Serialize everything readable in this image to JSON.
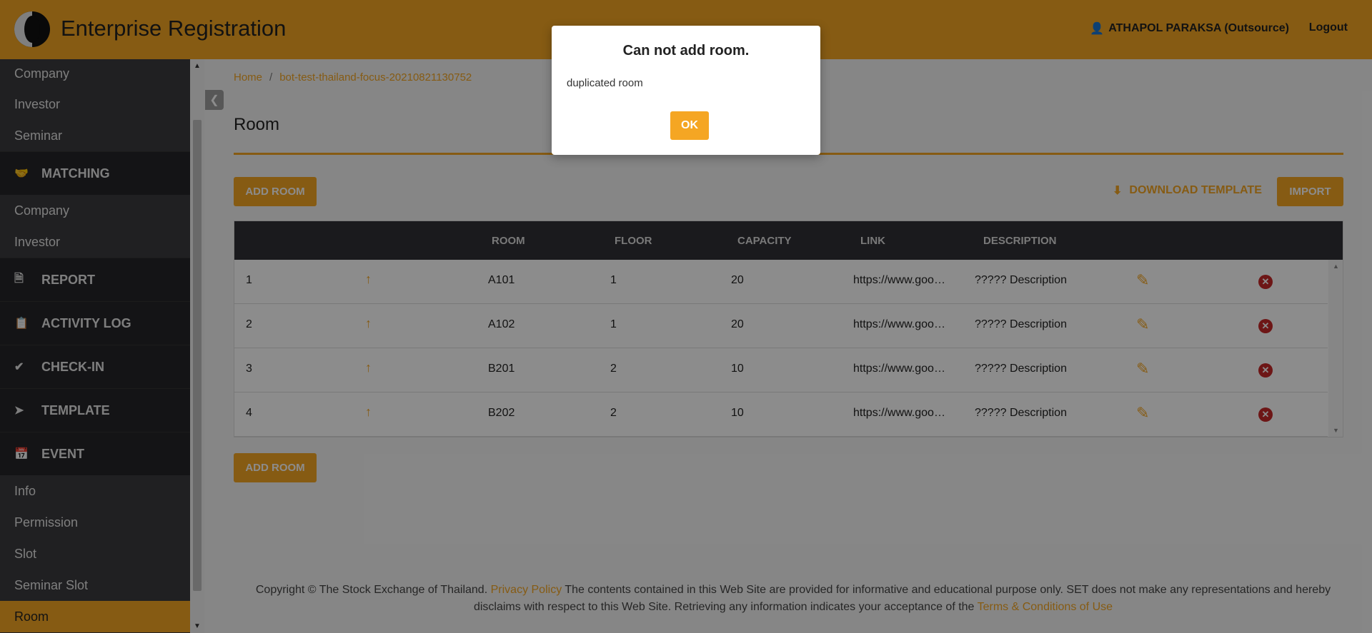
{
  "header": {
    "title": "Enterprise Registration",
    "user": "ATHAPOL PARAKSA (Outsource)",
    "logout": "Logout",
    "accent": "#f5a623"
  },
  "sidebar": {
    "items_top": [
      "Company",
      "Investor",
      "Seminar"
    ],
    "matching": "MATCHING",
    "matching_items": [
      "Company",
      "Investor"
    ],
    "report": "REPORT",
    "activity_log": "ACTIVITY LOG",
    "check_in": "CHECK-IN",
    "template": "TEMPLATE",
    "event": "EVENT",
    "event_items": [
      "Info",
      "Permission",
      "Slot",
      "Seminar Slot",
      "Room"
    ]
  },
  "breadcrumb": {
    "home": "Home",
    "sep": "/",
    "current": "bot-test-thailand-focus-20210821130752"
  },
  "page": {
    "title": "Room",
    "add_room": "ADD ROOM",
    "download_template": "DOWNLOAD TEMPLATE",
    "import": "IMPORT"
  },
  "table": {
    "headers": [
      "ROOM",
      "FLOOR",
      "CAPACITY",
      "LINK",
      "DESCRIPTION"
    ],
    "rows": [
      {
        "no": "1",
        "room": "A101",
        "floor": "1",
        "capacity": "20",
        "link": "https://www.goo…",
        "description": "????? Description"
      },
      {
        "no": "2",
        "room": "A102",
        "floor": "1",
        "capacity": "20",
        "link": "https://www.goo…",
        "description": "????? Description"
      },
      {
        "no": "3",
        "room": "B201",
        "floor": "2",
        "capacity": "10",
        "link": "https://www.goo…",
        "description": "????? Description"
      },
      {
        "no": "4",
        "room": "B202",
        "floor": "2",
        "capacity": "10",
        "link": "https://www.goo…",
        "description": "????? Description"
      }
    ]
  },
  "footer": {
    "text1": "Copyright © The Stock Exchange of Thailand.",
    "privacy": "Privacy Policy",
    "text2": "The contents contained in this Web Site are provided for informative and educational purpose only. SET does not make any representations and hereby disclaims with respect to this Web Site. Retrieving any information indicates your acceptance of the",
    "terms": "Terms & Conditions of Use"
  },
  "modal": {
    "title": "Can not add room.",
    "message": "duplicated room",
    "ok": "OK"
  }
}
